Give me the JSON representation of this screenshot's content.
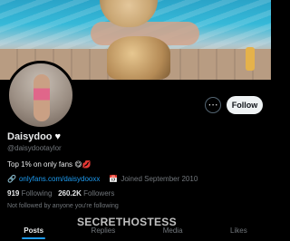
{
  "profile": {
    "name": "Daisydoo",
    "handle": "@daisydootaylor",
    "bio": "Top 1% on only fans 😋💋",
    "link": "onlyfans.com/daisydooxx",
    "joined": "Joined September 2010",
    "following_count": "919",
    "following_label": "Following",
    "followers_count": "260.2K",
    "followers_label": "Followers",
    "note": "Not followed by anyone you're following"
  },
  "actions": {
    "follow_label": "Follow",
    "more_icon": "more-icon"
  },
  "tabs": [
    {
      "label": "Posts"
    },
    {
      "label": "Replies"
    },
    {
      "label": "Media"
    },
    {
      "label": "Likes"
    }
  ],
  "watermark": "SECRETHOSTESS",
  "icons": {
    "verified": "heart-icon",
    "link": "link-icon",
    "calendar": "calendar-icon"
  },
  "colors": {
    "accent": "#1d9bf0",
    "background": "#000000"
  }
}
